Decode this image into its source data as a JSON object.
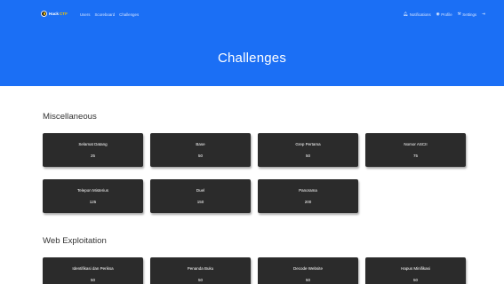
{
  "app": {
    "brand_text": "Hack",
    "brand_suffix": "CTF",
    "page_title": "Challenges"
  },
  "nav": {
    "left": [
      "Users",
      "Scoreboard",
      "Challenges"
    ],
    "right": [
      {
        "label": "Notifications",
        "icon": "bell-icon"
      },
      {
        "label": "Profile",
        "icon": "user-circle-icon"
      },
      {
        "label": "Settings",
        "icon": "wrench-icon"
      }
    ],
    "logout_icon": "logout-icon"
  },
  "categories": [
    {
      "title": "Miscellaneous",
      "challenges": [
        {
          "name": "Selamat Datang",
          "points": "25"
        },
        {
          "name": "Base",
          "points": "50"
        },
        {
          "name": "Grep Pertama",
          "points": "50"
        },
        {
          "name": "Nomor ASCII",
          "points": "75"
        },
        {
          "name": "Telepon Misterius",
          "points": "125"
        },
        {
          "name": "Duel",
          "points": "150"
        },
        {
          "name": "Panorama",
          "points": "200"
        }
      ]
    },
    {
      "title": "Web Exploitation",
      "challenges": [
        {
          "name": "Identifikasi dan Periksa",
          "points": "50"
        },
        {
          "name": "Penanda Buku",
          "points": "50"
        },
        {
          "name": "Decode Website",
          "points": "50"
        },
        {
          "name": "Hapus Minifikasi",
          "points": "50"
        }
      ]
    }
  ],
  "colors": {
    "primary": "#1b6ff5",
    "card_bg": "#2b2b2b",
    "brand_accent": "#f5c400"
  }
}
